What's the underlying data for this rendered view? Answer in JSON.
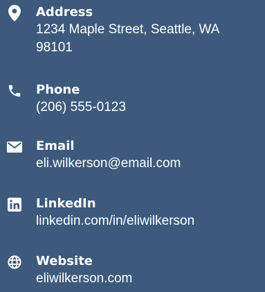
{
  "contact": {
    "address": {
      "icon": "map-pin-icon",
      "label": "Address",
      "value": "1234 Maple Street, Seattle, WA 98101"
    },
    "phone": {
      "icon": "phone-icon",
      "label": "Phone",
      "value": "(206) 555-0123"
    },
    "email": {
      "icon": "envelope-icon",
      "label": "Email",
      "value": "eli.wilkerson@email.com"
    },
    "linkedin": {
      "icon": "linkedin-icon",
      "label": "LinkedIn",
      "value": "linkedin.com/in/eliwilkerson"
    },
    "website": {
      "icon": "globe-icon",
      "label": "Website",
      "value": "eliwilkerson.com"
    }
  },
  "colors": {
    "background": "#3d5a7c",
    "text": "#ffffff"
  }
}
